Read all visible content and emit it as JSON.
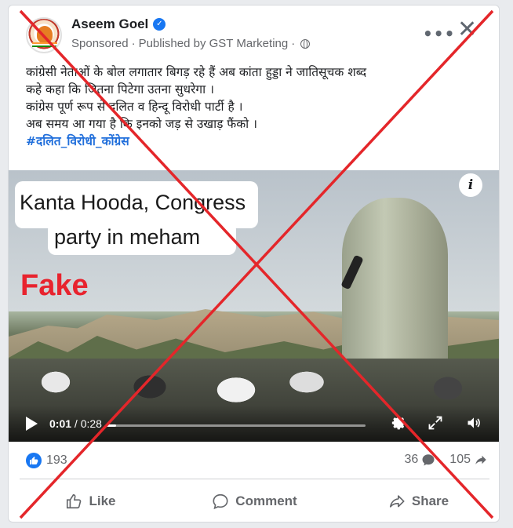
{
  "post": {
    "author": "Aseem Goel",
    "sponsored": "Sponsored",
    "separator": "·",
    "published_by": "Published by GST Marketing",
    "separator2": "·",
    "more_label": "•••",
    "close_label": "✕",
    "text_lines": [
      "कांग्रेसी नेताओं के बोल लगातार बिगड़ रहे हैं अब कांता हुड्डा ने जातिसूचक शब्द",
      "कहे  कहा कि जितना पिटेगा उतना सुधरेगा ।",
      "कांग्रेस  पूर्ण रूप से दलित व हिन्दू विरोधी पार्टी है ।",
      "अब समय आ गया है कि इनको जड़ से उखाड़ फैंको ।"
    ],
    "hashtag": "#दलित_विरोधी_कोंग्रेस"
  },
  "video": {
    "caption_line1": "Kanta Hooda, Congress",
    "caption_line2": "party in meham",
    "stamp": "Fake",
    "info_label": "i",
    "current_time": "0:01",
    "time_separator": " / ",
    "duration": "0:28",
    "progress": 0.036
  },
  "stats": {
    "reactions": "193",
    "comments": "36",
    "shares": "105"
  },
  "actions": {
    "like": "Like",
    "comment": "Comment",
    "share": "Share"
  },
  "colors": {
    "accent": "#1877f2",
    "overlay_x": "#e4262a",
    "stamp": "#e8232e",
    "hashtag": "#216fdb"
  }
}
